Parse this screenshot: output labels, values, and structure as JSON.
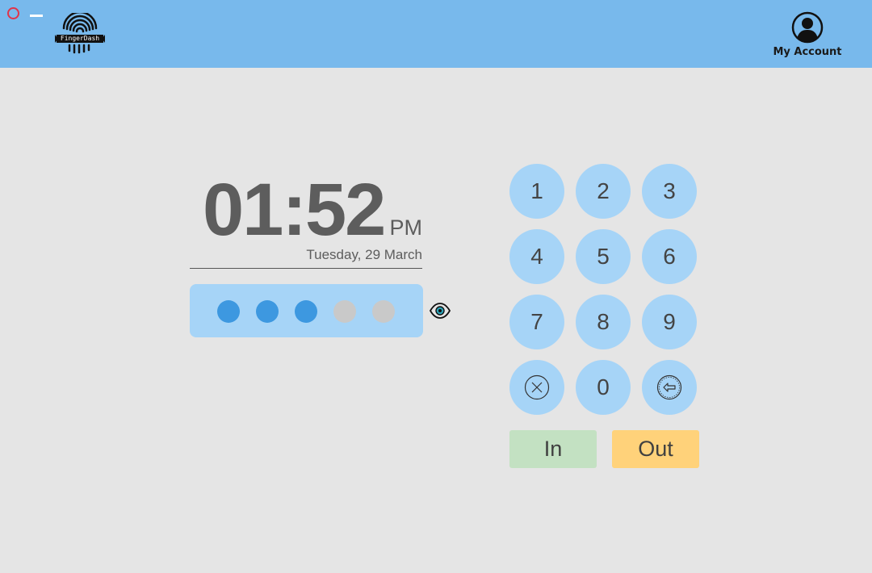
{
  "window": {
    "close_icon": "close-circle-icon",
    "minimize_icon": "minimize-icon"
  },
  "header": {
    "logo_text": "FingerDash",
    "account_label": "My Account",
    "account_icon": "user-circle-icon",
    "background": "#78b9ec"
  },
  "clock": {
    "time": "01:52",
    "ampm": "PM",
    "date": "Tuesday, 29 March"
  },
  "pin": {
    "length": 5,
    "filled_count": 3,
    "filled_color": "#3d98e0",
    "empty_color": "#c9c9c9",
    "toggle_icon": "eye-icon"
  },
  "keypad": {
    "keys": [
      "1",
      "2",
      "3",
      "4",
      "5",
      "6",
      "7",
      "8",
      "9",
      "clear",
      "0",
      "backspace"
    ],
    "clear_icon": "clear-x-icon",
    "backspace_icon": "backspace-arrow-icon",
    "key_color": "#a6d4f7"
  },
  "actions": {
    "in_label": "In",
    "out_label": "Out",
    "in_color": "#c3e1c2",
    "out_color": "#ffd27a"
  }
}
